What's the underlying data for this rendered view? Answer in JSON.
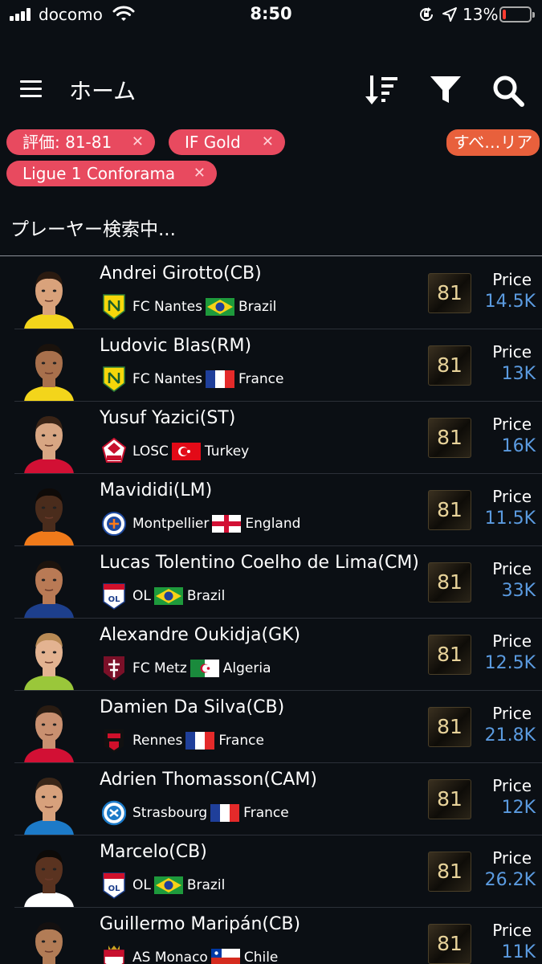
{
  "status_bar": {
    "carrier": "docomo",
    "time": "8:50",
    "battery_percent": "13%",
    "battery_level": 0.13
  },
  "header": {
    "title": "ホーム"
  },
  "filters": {
    "chips": [
      {
        "label": "評価: 81-81"
      },
      {
        "label": "IF Gold"
      },
      {
        "label": "Ligue 1 Conforama"
      }
    ],
    "all_label": "すべ…リア"
  },
  "search_status": "プレーヤー検索中...",
  "colors": {
    "chip_red": "#e84a5f",
    "chip_orange": "#e8603c",
    "price_blue": "#5b9be0",
    "background": "#0b0f14"
  },
  "players": [
    {
      "name": "Andrei Girotto(CB)",
      "club": "FC Nantes",
      "club_icon": "nantes-crest-icon",
      "country": "Brazil",
      "flag_icon": "brazil-flag-icon",
      "rating": "81",
      "price_label": "Price",
      "price": "14.5K"
    },
    {
      "name": "Ludovic Blas(RM)",
      "club": "FC Nantes",
      "club_icon": "nantes-crest-icon",
      "country": "France",
      "flag_icon": "france-flag-icon",
      "rating": "81",
      "price_label": "Price",
      "price": "13K"
    },
    {
      "name": "Yusuf Yazici(ST)",
      "club": "LOSC",
      "club_icon": "losc-crest-icon",
      "country": "Turkey",
      "flag_icon": "turkey-flag-icon",
      "rating": "81",
      "price_label": "Price",
      "price": "16K"
    },
    {
      "name": "Mavididi(LM)",
      "club": "Montpellier",
      "club_icon": "montpellier-crest-icon",
      "country": "England",
      "flag_icon": "england-flag-icon",
      "rating": "81",
      "price_label": "Price",
      "price": "11.5K"
    },
    {
      "name": "Lucas Tolentino Coelho de Lima(CM)",
      "club": "OL",
      "club_icon": "ol-crest-icon",
      "country": "Brazil",
      "flag_icon": "brazil-flag-icon",
      "rating": "81",
      "price_label": "Price",
      "price": "33K"
    },
    {
      "name": "Alexandre Oukidja(GK)",
      "club": "FC Metz",
      "club_icon": "metz-crest-icon",
      "country": "Algeria",
      "flag_icon": "algeria-flag-icon",
      "rating": "81",
      "price_label": "Price",
      "price": "12.5K"
    },
    {
      "name": "Damien Da Silva(CB)",
      "club": "Rennes",
      "club_icon": "rennes-crest-icon",
      "country": "France",
      "flag_icon": "france-flag-icon",
      "rating": "81",
      "price_label": "Price",
      "price": "21.8K"
    },
    {
      "name": "Adrien Thomasson(CAM)",
      "club": "Strasbourg",
      "club_icon": "strasbourg-crest-icon",
      "country": "France",
      "flag_icon": "france-flag-icon",
      "rating": "81",
      "price_label": "Price",
      "price": "12K"
    },
    {
      "name": "Marcelo(CB)",
      "club": "OL",
      "club_icon": "ol-crest-icon",
      "country": "Brazil",
      "flag_icon": "brazil-flag-icon",
      "rating": "81",
      "price_label": "Price",
      "price": "26.2K"
    },
    {
      "name": "Guillermo Maripán(CB)",
      "club": "AS Monaco",
      "club_icon": "monaco-crest-icon",
      "country": "Chile",
      "flag_icon": "chile-flag-icon",
      "rating": "81",
      "price_label": "Price",
      "price": "11K"
    }
  ]
}
